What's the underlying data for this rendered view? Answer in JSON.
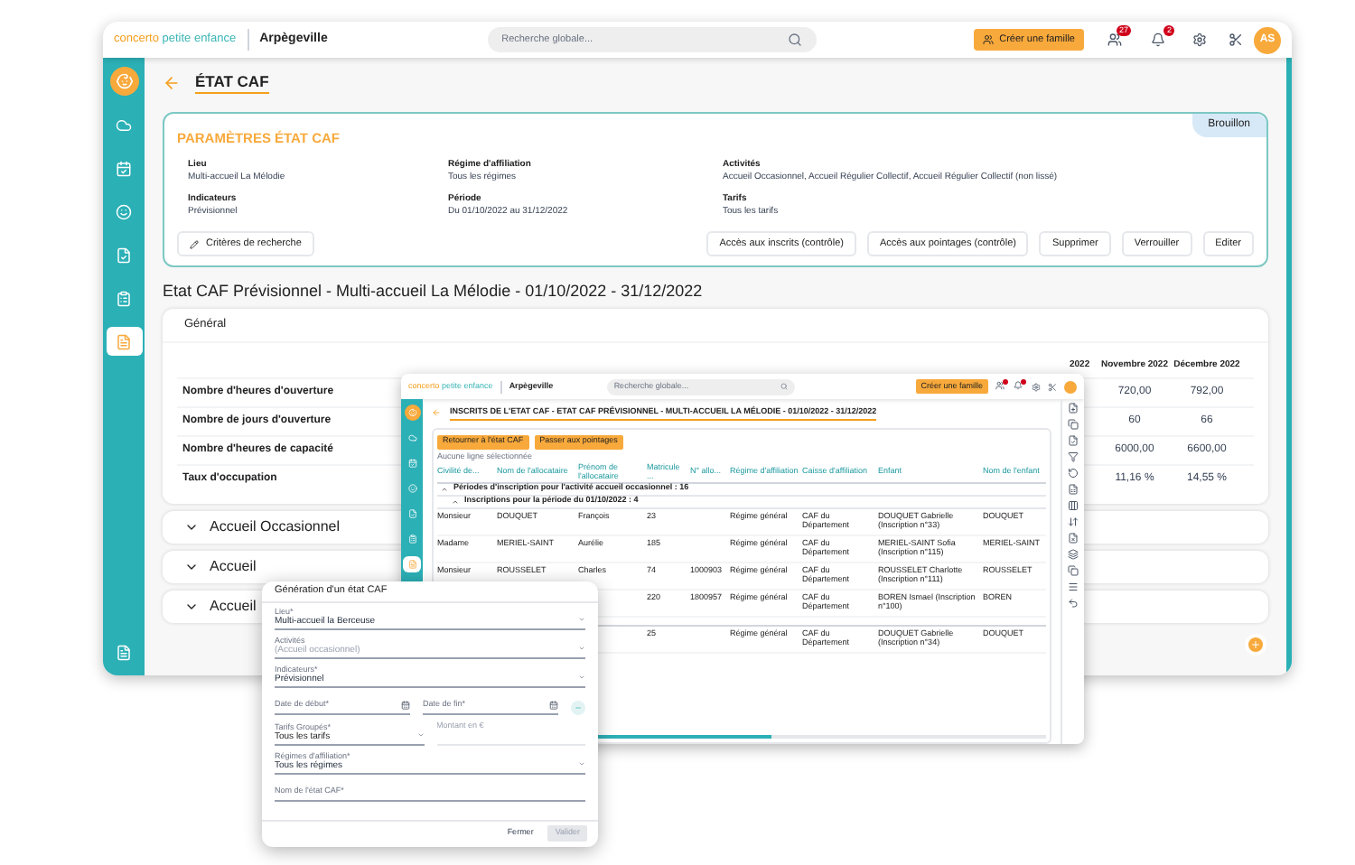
{
  "header": {
    "brand_main": "concerto",
    "brand_sub": "petite enfance",
    "site": "Arpègeville",
    "search_placeholder": "Recherche globale...",
    "create_button": "Créer une famille",
    "badges": [
      "27",
      "2"
    ],
    "avatar": "AS"
  },
  "sidebar": [
    {
      "selected": false
    },
    {
      "selected": false
    },
    {
      "selected": false
    },
    {
      "selected": false
    },
    {
      "selected": false
    },
    {
      "selected": true
    }
  ],
  "page": {
    "title": "ÉTAT CAF"
  },
  "params": {
    "title": "PARAMÈTRES ÉTAT CAF",
    "status": "Brouillon",
    "fields": [
      {
        "label": "Lieu",
        "value": "Multi-accueil La Mélodie"
      },
      {
        "label": "Régime d'affiliation",
        "value": "Tous les régimes"
      },
      {
        "label": "Activités",
        "value": "Accueil Occasionnel, Accueil Régulier Collectif, Accueil Régulier Collectif (non lissé)"
      },
      {
        "label": "Indicateurs",
        "value": "Prévisionnel"
      },
      {
        "label": "Période",
        "value": "Du 01/10/2022 au 31/12/2022"
      },
      {
        "label": "Tarifs",
        "value": "Tous les tarifs"
      }
    ],
    "search_button": "Critères de recherche",
    "actions": [
      "Accès aux inscrits (contrôle)",
      "Accès aux pointages (contrôle)",
      "Supprimer",
      "Verrouiller",
      "Editer"
    ]
  },
  "report": {
    "heading": "Etat CAF Prévisionnel - Multi-accueil La Mélodie - 01/10/2022 - 31/12/2022",
    "general": {
      "title": "Général",
      "columns": [
        "2022",
        "Novembre 2022",
        "Décembre 2022"
      ],
      "rows": [
        {
          "label": "Nombre d'heures d'ouverture",
          "values": [
            "720,00",
            "792,00"
          ]
        },
        {
          "label": "Nombre de jours d'ouverture",
          "values": [
            "60",
            "66"
          ]
        },
        {
          "label": "Nombre d'heures de capacité",
          "values": [
            "6000,00",
            "6600,00"
          ]
        },
        {
          "label": "Taux d'occupation",
          "values": [
            "11,16 %",
            "14,55 %"
          ]
        }
      ]
    },
    "sections": [
      {
        "title": "Accueil Occasionnel",
        "expanded": false
      },
      {
        "title": "Accueil",
        "expanded": false
      },
      {
        "title": "Accueil",
        "expanded": false
      }
    ]
  },
  "inscrits_window": {
    "brand_main": "concerto",
    "brand_sub": "petite enfance",
    "site": "Arpègeville",
    "search_placeholder": "Recherche globale...",
    "create_button": "Créer une famille",
    "sidebar": [
      {
        "selected": false
      },
      {
        "selected": false
      },
      {
        "selected": false
      },
      {
        "selected": false
      },
      {
        "selected": false
      },
      {
        "selected": true
      }
    ],
    "title": "INSCRITS DE L'ETAT CAF - ETAT CAF PRÉVISIONNEL - MULTI-ACCUEIL LA MÉLODIE - 01/10/2022 - 31/12/2022",
    "buttons": [
      "Retourner à l'état CAF",
      "Passer aux pointages"
    ],
    "selection_info": "Aucune ligne sélectionnée",
    "columns": [
      "Civilité de...",
      "Nom de l'allocataire",
      "Prénom de l'allocataire",
      "Matricule ...",
      "N° allo...",
      "Régime d'affiliation",
      "Caisse d'affiliation",
      "Enfant",
      "Nom de l'enfant"
    ],
    "rows": [
      {
        "kind": "group",
        "text": "Périodes d'inscription pour l'activité accueil occasionnel : 16",
        "expanded": true
      },
      {
        "kind": "subgroup",
        "text": "Inscriptions pour la période du 01/10/2022 : 4",
        "expanded": true
      },
      {
        "kind": "data",
        "cells": [
          "Monsieur",
          "DOUQUET",
          "François",
          "23",
          null,
          "Régime général",
          "CAF du Département",
          "DOUQUET Gabrielle (Inscription n°33)",
          "DOUQUET"
        ]
      },
      {
        "kind": "data",
        "cells": [
          "Madame",
          "MERIEL-SAINT",
          "Aurélie",
          "185",
          null,
          "Régime général",
          "CAF du Département",
          "MERIEL-SAINT Sofia (Inscription n°115)",
          "MERIEL-SAINT"
        ]
      },
      {
        "kind": "data",
        "cells": [
          "Monsieur",
          "ROUSSELET",
          "Charles",
          "74",
          "1000903",
          "Régime général",
          "CAF du Département",
          "ROUSSELET Charlotte (Inscription n°111)",
          "ROUSSELET"
        ]
      },
      {
        "kind": "data",
        "cells": [
          null,
          null,
          null,
          "220",
          "1800957",
          "Régime général",
          "CAF du Département",
          "BOREN Ismael (Inscription n°100)",
          "BOREN"
        ]
      },
      {
        "kind": "spacer"
      },
      {
        "kind": "data",
        "cells": [
          null,
          null,
          null,
          "25",
          null,
          "Régime général",
          "CAF du Département",
          "DOUQUET Gabrielle (Inscription n°34)",
          "DOUQUET"
        ]
      }
    ]
  },
  "dialog": {
    "title": "Génération d'un état CAF",
    "fields": [
      {
        "kind": "select",
        "label": "Lieu*",
        "value": "Multi-accueil la Berceuse"
      },
      {
        "kind": "select",
        "label": "Activités",
        "placeholder": "(Accueil occasionnel)"
      },
      {
        "kind": "select",
        "label": "Indicateurs*",
        "value": "Prévisionnel"
      },
      {
        "kind": "dates",
        "placeholder": "Date de début*",
        "placeholder_end": "Date de fin*"
      },
      {
        "kind": "tarif",
        "label": "Tarifs Groupés*",
        "value": "Tous les tarifs",
        "placeholder_amount": "Montant en €"
      },
      {
        "kind": "select",
        "label": "Régimes d'affiliation*",
        "value": "Tous les régimes"
      },
      {
        "kind": "text",
        "placeholder": "Nom de l'état CAF*"
      }
    ],
    "buttons": [
      "Fermer",
      "Valider"
    ]
  }
}
